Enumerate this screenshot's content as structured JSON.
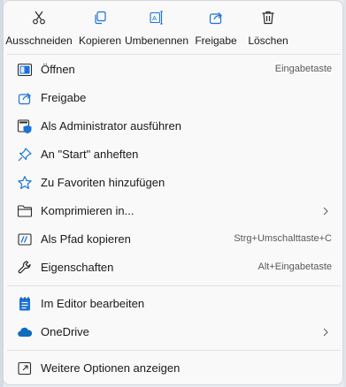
{
  "toolbar": {
    "cut": "Ausschneiden",
    "copy": "Kopieren",
    "rename": "Umbenennen",
    "share": "Freigabe",
    "delete": "Löschen"
  },
  "items": {
    "open": {
      "label": "Öffnen",
      "shortcut": "Eingabetaste"
    },
    "share": {
      "label": "Freigabe"
    },
    "run_as_admin": {
      "label": "Als Administrator ausführen"
    },
    "pin_start": {
      "label": "An \"Start\" anheften"
    },
    "add_favorites": {
      "label": "Zu Favoriten hinzufügen"
    },
    "compress": {
      "label": "Komprimieren in..."
    },
    "copy_path": {
      "label": "Als Pfad kopieren",
      "shortcut": "Strg+Umschalttaste+C"
    },
    "properties": {
      "label": "Eigenschaften",
      "shortcut": "Alt+Eingabetaste"
    },
    "edit_editor": {
      "label": "Im Editor bearbeiten"
    },
    "onedrive": {
      "label": "OneDrive"
    },
    "more_options": {
      "label": "Weitere Optionen anzeigen"
    }
  },
  "colors": {
    "accent": "#1a73d9",
    "onedrive": "#0f6cbd",
    "shield": "#1a73d9"
  }
}
